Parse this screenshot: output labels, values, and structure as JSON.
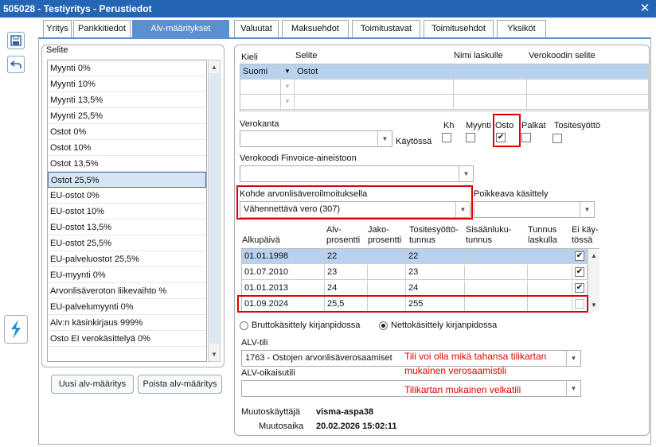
{
  "window": {
    "title": "505028 - Testiyritys - Perustiedot"
  },
  "tabs": [
    "Yritys",
    "Pankkitiedot",
    "Alv-määritykset",
    "Valuutat",
    "Maksuehdot",
    "Toimitustavat",
    "Toimitusehdot",
    "Yksiköt"
  ],
  "left": {
    "header": "Selite",
    "items": [
      "Myynti 0%",
      "Myynti 10%",
      "Myynti 13,5%",
      "Myynti 25,5%",
      "Ostot 0%",
      "Ostot 10%",
      "Ostot 13,5%",
      "Ostot 25,5%",
      "EU-ostot 0%",
      "EU-ostot 10%",
      "EU-ostot 13,5%",
      "EU-ostot 25,5%",
      "EU-palveluostot 25,5%",
      "EU-myynti 0%",
      "Arvonlisäveroton liikevaihto %",
      "EU-palvelumyynti 0%",
      "Alv:n käsinkirjaus 999%",
      "Osto EI verokäsittelyä 0%"
    ],
    "selected_index": 7,
    "add_button": "Uusi alv-määritys",
    "delete_button": "Poista alv-määritys"
  },
  "lang_grid": {
    "headers": [
      "Kieli",
      "Selite",
      "Nimi laskulle",
      "Verokoodin selite"
    ],
    "rows": [
      [
        "Suomi",
        "Ostot",
        "",
        ""
      ],
      [
        "",
        "",
        "",
        ""
      ],
      [
        "",
        "",
        "",
        ""
      ]
    ]
  },
  "verokanta": {
    "label": "Verokanta",
    "value": ""
  },
  "flags": {
    "kaytossa_label": "Käytössä",
    "kh": "Kh",
    "myynti": "Myynti",
    "osto": "Osto",
    "palkat": "Palkat",
    "tositesyotto": "Tositesyöttö",
    "osto_checked": "✔"
  },
  "finvoice": {
    "label": "Verokoodi Finvoice-aineistoon",
    "value": ""
  },
  "kohde": {
    "label": "Kohde arvonlisäveroilmoituksella",
    "value": "Vähennettävä vero (307)"
  },
  "poikkeava": {
    "label": "Poikkeava käsittely",
    "value": ""
  },
  "rates": {
    "headers": {
      "alkupaiva": "Alkupäivä",
      "alv1": "Alv-",
      "alv2": "prosentti",
      "jako1": "Jako-",
      "jako2": "prosentti",
      "tos1": "Tositesyöttö-",
      "tos2": "tunnus",
      "sis1": "Sisäänluku-",
      "sis2": "tunnus",
      "tun1": "Tunnus",
      "tun2": "laskulla",
      "ei1": "Ei käy-",
      "ei2": "tössä"
    },
    "rows": [
      {
        "date": "01.01.1998",
        "alv": "22",
        "jako": "",
        "tos": "22",
        "sis": "",
        "tun": "",
        "ei": "✔"
      },
      {
        "date": "01.07.2010",
        "alv": "23",
        "jako": "",
        "tos": "23",
        "sis": "",
        "tun": "",
        "ei": "✔"
      },
      {
        "date": "01.01.2013",
        "alv": "24",
        "jako": "",
        "tos": "24",
        "sis": "",
        "tun": "",
        "ei": "✔"
      },
      {
        "date": "01.09.2024",
        "alv": "25,5",
        "jako": "",
        "tos": "255",
        "sis": "",
        "tun": "",
        "ei": ""
      }
    ]
  },
  "radios": {
    "brutto": "Bruttokäsittely kirjanpidossa",
    "netto": "Nettokäsittely kirjanpidossa",
    "selected": "netto"
  },
  "alv_tili": {
    "label": "ALV-tili",
    "value": "1763 - Ostojen arvonlisäverosaamiset"
  },
  "alv_oikaisu": {
    "label": "ALV-oikaisutili",
    "value": ""
  },
  "annotations": {
    "line1": "Tili voi olla mikä tahansa tilikartan",
    "line2": "mukainen verosaamistili",
    "line3": "Tilikartan mukainen velkatili"
  },
  "meta": {
    "user_label": "Muutoskäyttäjä",
    "user": "visma-aspa38",
    "time_label": "Muutosaika",
    "time": "20.02.2026 15:02:11"
  },
  "icons": {
    "save": "save-icon",
    "back": "back-icon",
    "app": "visma-app-icon",
    "close": "close-icon"
  },
  "colors": {
    "titlebar": "#2466b4",
    "tab_active": "#5c8fd0",
    "row_highlight": "#b8d1ef",
    "annotation": "#e00000"
  }
}
